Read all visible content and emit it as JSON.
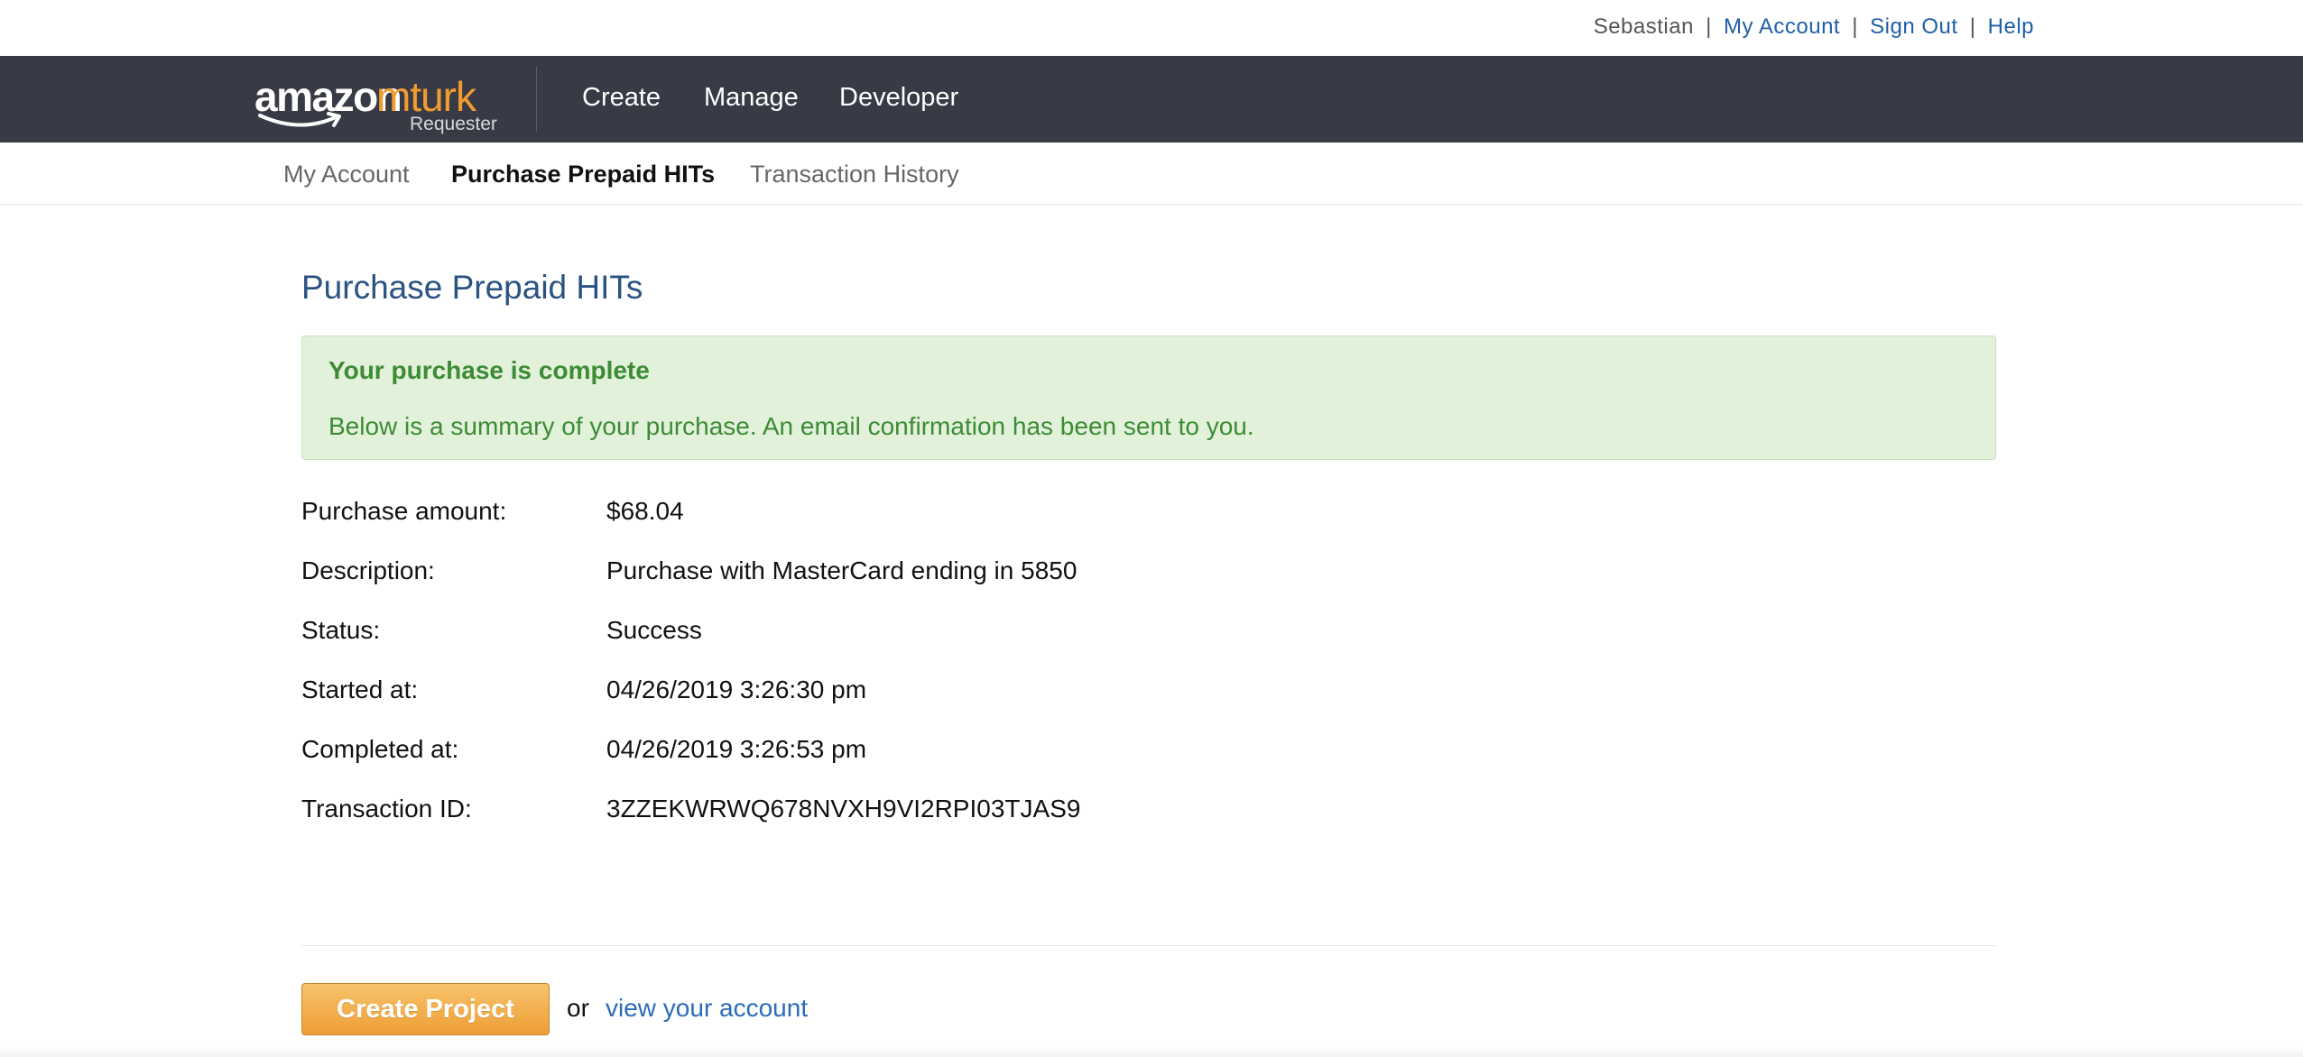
{
  "header": {
    "user_name": "Sebastian",
    "sep": "|",
    "my_account_link": "My Account",
    "sign_out_link": "Sign Out",
    "help_link": "Help"
  },
  "nav": {
    "logo_amazon": "amazon",
    "logo_mturk": "mturk",
    "logo_requester": "Requester",
    "items": [
      {
        "label": "Create"
      },
      {
        "label": "Manage"
      },
      {
        "label": "Developer"
      }
    ]
  },
  "sub_nav": {
    "items": [
      {
        "label": "My Account",
        "active": false
      },
      {
        "label": "Purchase Prepaid HITs",
        "active": true
      },
      {
        "label": "Transaction History",
        "active": false
      }
    ]
  },
  "main": {
    "page_title": "Purchase Prepaid HITs",
    "alert": {
      "title": "Your purchase is complete",
      "body": "Below is a summary of your purchase. An email confirmation has been sent to you."
    },
    "details": [
      {
        "label": "Purchase amount:",
        "value": "$68.04"
      },
      {
        "label": "Description:",
        "value": "Purchase with MasterCard ending in 5850"
      },
      {
        "label": "Status:",
        "value": "Success"
      },
      {
        "label": "Started at:",
        "value": "04/26/2019 3:26:30 pm"
      },
      {
        "label": "Completed at:",
        "value": "04/26/2019 3:26:53 pm"
      },
      {
        "label": "Transaction ID:",
        "value": "3ZZEKWRWQ678NVXH9VI2RPI03TJAS9"
      }
    ],
    "create_project_button": "Create Project",
    "or_text": "or",
    "view_account_link": "view your account"
  },
  "colors": {
    "nav_bg": "#383b45",
    "accent_orange": "#f29b30",
    "link_blue": "#1f5fa8",
    "title_blue": "#2b5382",
    "success_green": "#3d8b36",
    "success_bg": "#e2f1da"
  }
}
